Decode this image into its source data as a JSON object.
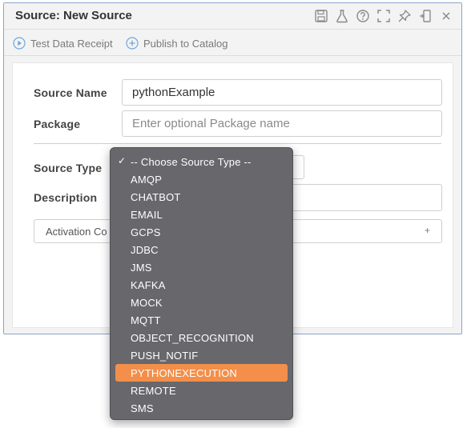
{
  "window": {
    "title": "Source: New Source",
    "icons": [
      "save-icon",
      "flask-icon",
      "help-icon",
      "fullscreen-icon",
      "pin-icon",
      "dock-icon",
      "close-icon"
    ]
  },
  "toolbar": {
    "test_label": "Test Data Receipt",
    "publish_label": "Publish to Catalog"
  },
  "form": {
    "source_name_label": "Source Name",
    "source_name_value": "pythonExample",
    "package_label": "Package",
    "package_placeholder": "Enter optional Package name",
    "source_type_label": "Source Type",
    "description_label": "Description",
    "activation_label": "Activation Co",
    "activation_plus": "+"
  },
  "dropdown": {
    "options": [
      "-- Choose Source Type --",
      "AMQP",
      "CHATBOT",
      "EMAIL",
      "GCPS",
      "JDBC",
      "JMS",
      "KAFKA",
      "MOCK",
      "MQTT",
      "OBJECT_RECOGNITION",
      "PUSH_NOTIF",
      "PYTHONEXECUTION",
      "REMOTE",
      "SMS"
    ],
    "checked": "-- Choose Source Type --",
    "highlighted": "PYTHONEXECUTION",
    "highlight_color": "#f38f4a"
  }
}
